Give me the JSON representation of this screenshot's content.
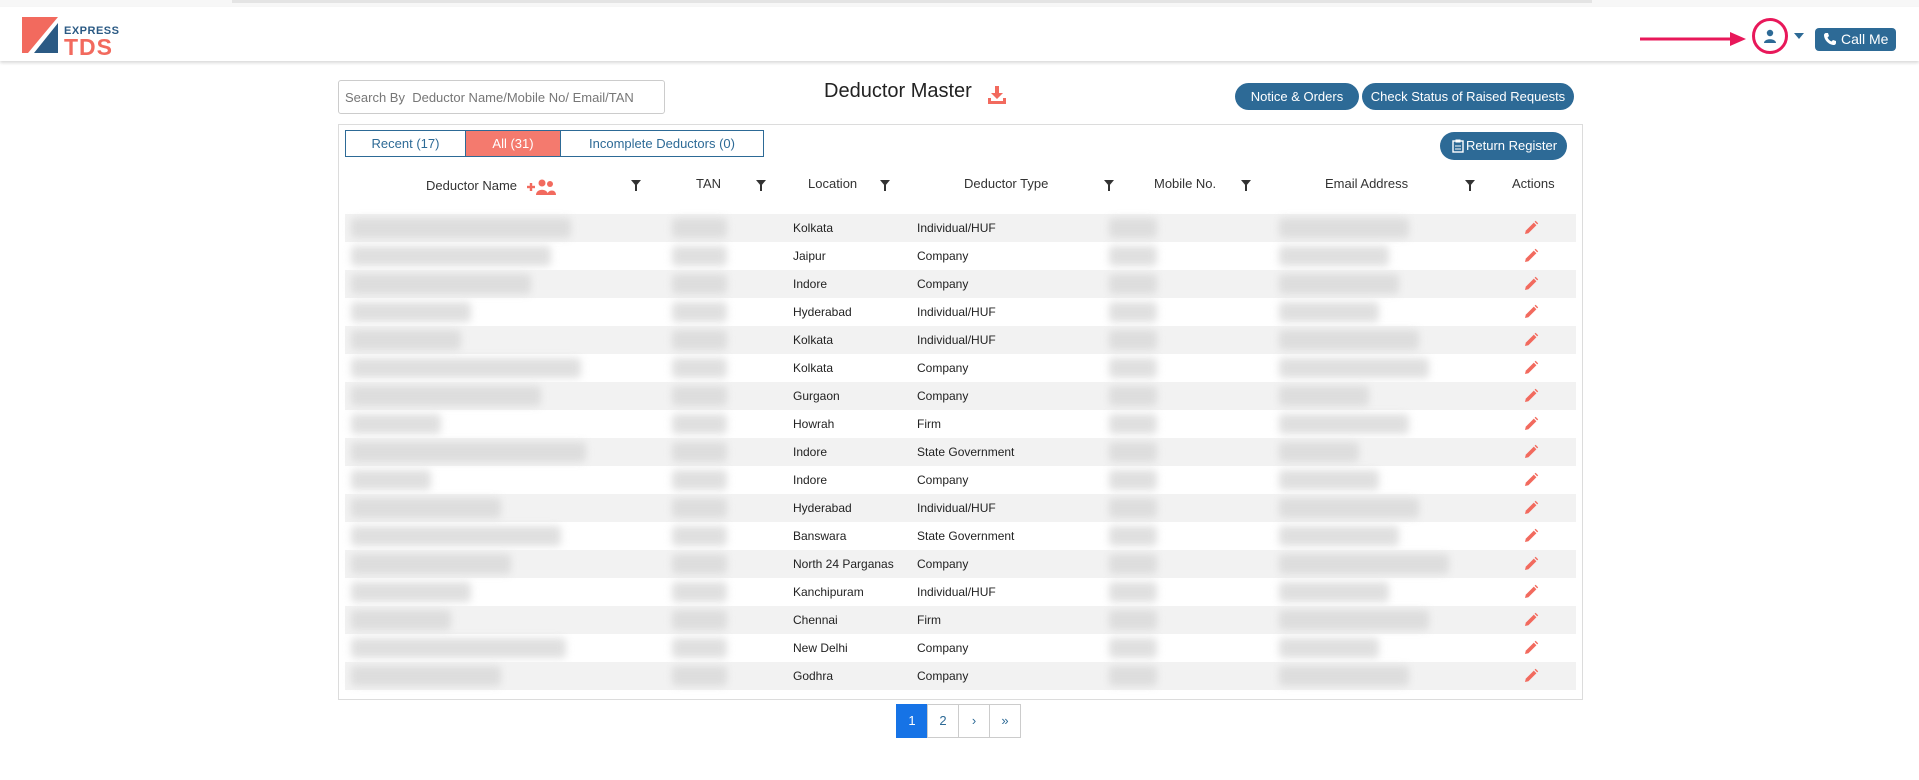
{
  "header": {
    "logo_top": "EXPRESS",
    "logo_bottom": "TDS",
    "call_label": "Call Me"
  },
  "search": {
    "placeholder": "Search By  Deductor Name/Mobile No/ Email/TAN"
  },
  "page_title": "Deductor Master",
  "buttons": {
    "notice": "Notice & Orders",
    "status": "Check Status of Raised Requests",
    "return_register": "Return Register"
  },
  "tabs": [
    {
      "label": "Recent (17)",
      "active": false
    },
    {
      "label": "All (31)",
      "active": true
    },
    {
      "label": "Incomplete Deductors (0)",
      "active": false
    }
  ],
  "columns": {
    "name": "Deductor Name",
    "tan": "TAN",
    "location": "Location",
    "type": "Deductor Type",
    "mobile": "Mobile No.",
    "email": "Email Address",
    "actions": "Actions"
  },
  "rows": [
    {
      "location": "Kolkata",
      "type": "Individual/HUF"
    },
    {
      "location": "Jaipur",
      "type": "Company"
    },
    {
      "location": "Indore",
      "type": "Company"
    },
    {
      "location": "Hyderabad",
      "type": "Individual/HUF"
    },
    {
      "location": "Kolkata",
      "type": "Individual/HUF"
    },
    {
      "location": "Kolkata",
      "type": "Company"
    },
    {
      "location": "Gurgaon",
      "type": "Company"
    },
    {
      "location": "Howrah",
      "type": "Firm"
    },
    {
      "location": "Indore",
      "type": "State Government"
    },
    {
      "location": "Indore",
      "type": "Company"
    },
    {
      "location": "Hyderabad",
      "type": "Individual/HUF"
    },
    {
      "location": "Banswara",
      "type": "State Government"
    },
    {
      "location": "North 24 Parganas",
      "type": "Company"
    },
    {
      "location": "Kanchipuram",
      "type": "Individual/HUF"
    },
    {
      "location": "Chennai",
      "type": "Firm"
    },
    {
      "location": "New Delhi",
      "type": "Company"
    },
    {
      "location": "Godhra",
      "type": "Company"
    }
  ],
  "pagination": {
    "pages": [
      "1",
      "2"
    ],
    "next": "›",
    "last": "»",
    "current": "1"
  },
  "colors": {
    "primary": "#2d6a96",
    "accent": "#f47a6e",
    "highlight": "#e8185a",
    "page_active": "#1673e6"
  },
  "icons": [
    "user-icon",
    "phone-icon",
    "download-icon",
    "add-user-icon",
    "filter-icon",
    "pencil-icon",
    "clipboard-icon"
  ]
}
